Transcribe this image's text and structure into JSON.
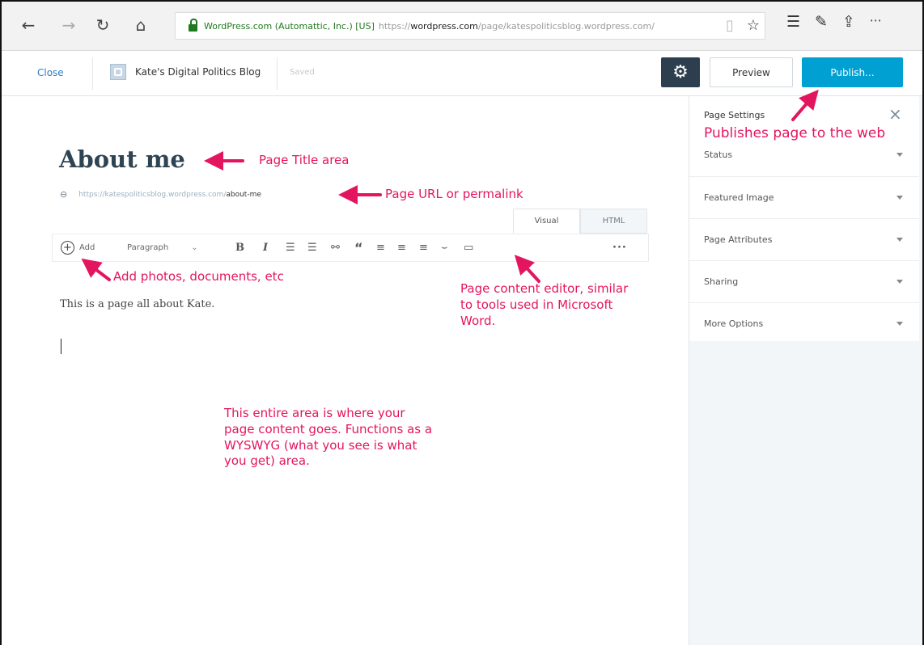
{
  "browser": {
    "back_icon": "←",
    "forward_icon": "→",
    "refresh_icon": "↻",
    "home_icon": "⌂",
    "cert_label": "WordPress.com (Automattic, Inc.) [US]",
    "url_prefix": "https://",
    "url_domain": "wordpress.com",
    "url_path": "/page/katespoliticsblog.wordpress.com/"
  },
  "editor_header": {
    "close_label": "Close",
    "site_name": "Kate's Digital Politics Blog",
    "save_status": "Saved",
    "preview_label": "Preview",
    "publish_label": "Publish..."
  },
  "sidebar": {
    "title": "Page Settings",
    "sections": [
      {
        "label": "Status"
      },
      {
        "label": "Featured Image"
      },
      {
        "label": "Page Attributes"
      },
      {
        "label": "Sharing"
      },
      {
        "label": "More Options"
      }
    ]
  },
  "content": {
    "page_title": "About me",
    "permalink_base": "https://katespoliticsblog.wordpress.com/",
    "permalink_slug": "about-me",
    "tab_visual": "Visual",
    "tab_html": "HTML",
    "add_label": "Add",
    "format_select": "Paragraph",
    "body_text": "This is a page all about Kate."
  },
  "annotations": {
    "publish": "Publishes page to the web",
    "title": "Page Title area",
    "url": "Page URL or permalink",
    "add": "Add photos, documents, etc",
    "editor_line1": "Page content editor, similar",
    "editor_line2": "to tools used in Microsoft",
    "editor_line3": "Word.",
    "area_line1": "This entire area is where your",
    "area_line2": "page content goes. Functions as a",
    "area_line3": "WYSWYG (what you see is what",
    "area_line4": "you get) area."
  },
  "colors": {
    "annotation": "#e4155f",
    "publish_button": "#00a0d2",
    "gear_button": "#2d3f4e",
    "link": "#2e7bc4"
  }
}
